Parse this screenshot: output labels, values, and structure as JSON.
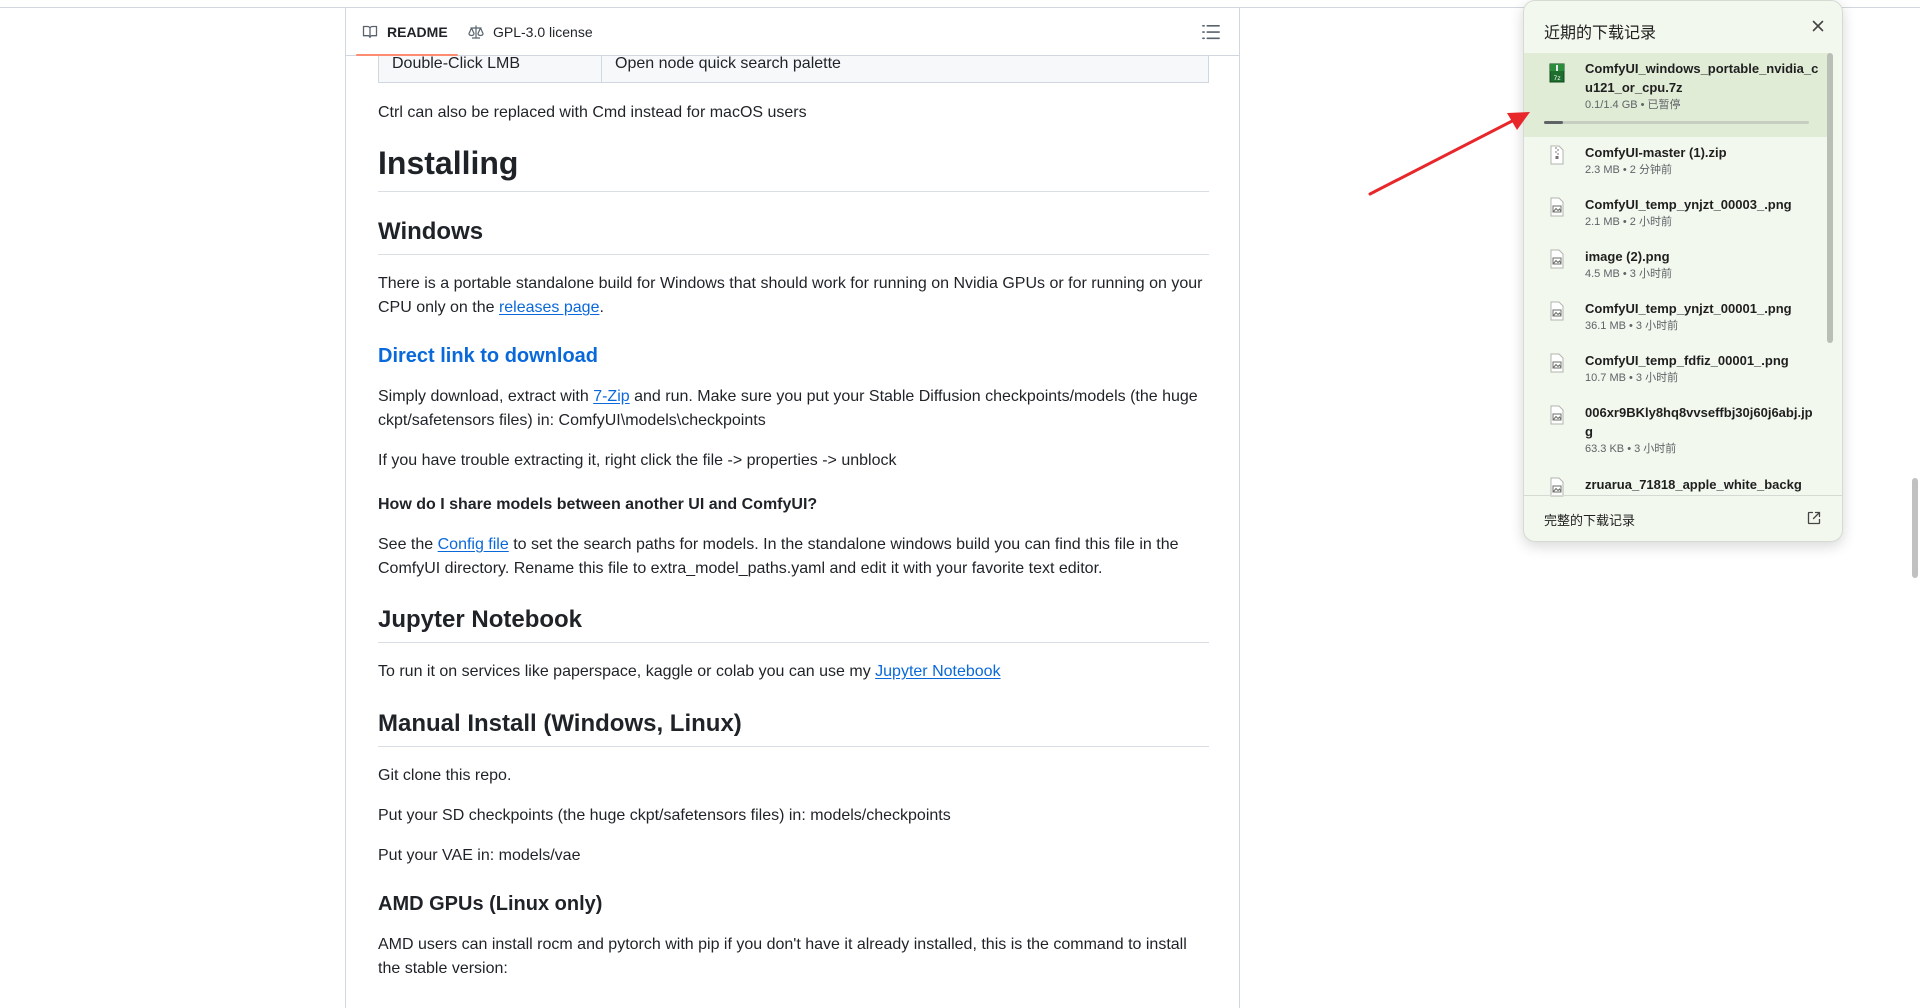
{
  "readme": {
    "tabs": [
      {
        "label": "README",
        "icon": "book-icon"
      },
      {
        "label": "GPL-3.0 license",
        "icon": "law-icon"
      }
    ],
    "table": {
      "key": "Double-Click LMB",
      "value": "Open node quick search palette"
    },
    "mac_note": "Ctrl can also be replaced with Cmd instead for macOS users",
    "installing": "Installing",
    "windows": "Windows",
    "windows_p1_a": "There is a portable standalone build for Windows that should work for running on Nvidia GPUs or for running on your CPU only on the ",
    "windows_link": "releases page",
    "windows_p1_b": ".",
    "direct_link": "Direct link to download",
    "simply_a": "Simply download, extract with ",
    "simply_link": "7-Zip",
    "simply_b": " and run. Make sure you put your Stable Diffusion checkpoints/models (the huge ckpt/safetensors files) in: ComfyUI\\models\\checkpoints",
    "trouble": "If you have trouble extracting it, right click the file -> properties -> unblock",
    "share_q": "How do I share models between another UI and ComfyUI?",
    "config_a": "See the ",
    "config_link": "Config file",
    "config_b": " to set the search paths for models. In the standalone windows build you can find this file in the ComfyUI directory. Rename this file to extra_model_paths.yaml and edit it with your favorite text editor.",
    "jupyter": "Jupyter Notebook",
    "jupyter_a": "To run it on services like paperspace, kaggle or colab you can use my ",
    "jupyter_link": "Jupyter Notebook",
    "manual": "Manual Install (Windows, Linux)",
    "git": "Git clone this repo.",
    "sd": "Put your SD checkpoints (the huge ckpt/safetensors files) in: models/checkpoints",
    "vae": "Put your VAE in: models/vae",
    "amd": "AMD GPUs (Linux only)",
    "amd_p": "AMD users can install rocm and pytorch with pip if you don't have it already installed, this is the command to install the stable version:"
  },
  "downloads": {
    "title": "近期的下载记录",
    "footer": "完整的下载记录",
    "progress_fraction": 0.07,
    "items": [
      {
        "name": "ComfyUI_windows_portable_nvidia_cu121_or_cpu.7z",
        "meta": "0.1/1.4 GB • 已暂停",
        "icon": "archive-7z-icon"
      },
      {
        "name": "ComfyUI-master (1).zip",
        "meta": "2.3 MB • 2 分钟前",
        "icon": "zip-file-icon"
      },
      {
        "name": "ComfyUI_temp_ynjzt_00003_.png",
        "meta": "2.1 MB • 2 小时前",
        "icon": "image-file-icon"
      },
      {
        "name": "image (2).png",
        "meta": "4.5 MB • 3 小时前",
        "icon": "image-file-icon"
      },
      {
        "name": "ComfyUI_temp_ynjzt_00001_.png",
        "meta": "36.1 MB • 3 小时前",
        "icon": "image-file-icon"
      },
      {
        "name": "ComfyUI_temp_fdfiz_00001_.png",
        "meta": "10.7 MB • 3 小时前",
        "icon": "image-file-icon"
      },
      {
        "name": "006xr9BKly8hq8vvseffbj30j60j6abj.jpg",
        "meta": "63.3 KB • 3 小时前",
        "icon": "image-file-icon"
      },
      {
        "name": "zruarua_71818_apple_white_backg",
        "meta": "",
        "icon": "image-file-icon"
      }
    ]
  }
}
